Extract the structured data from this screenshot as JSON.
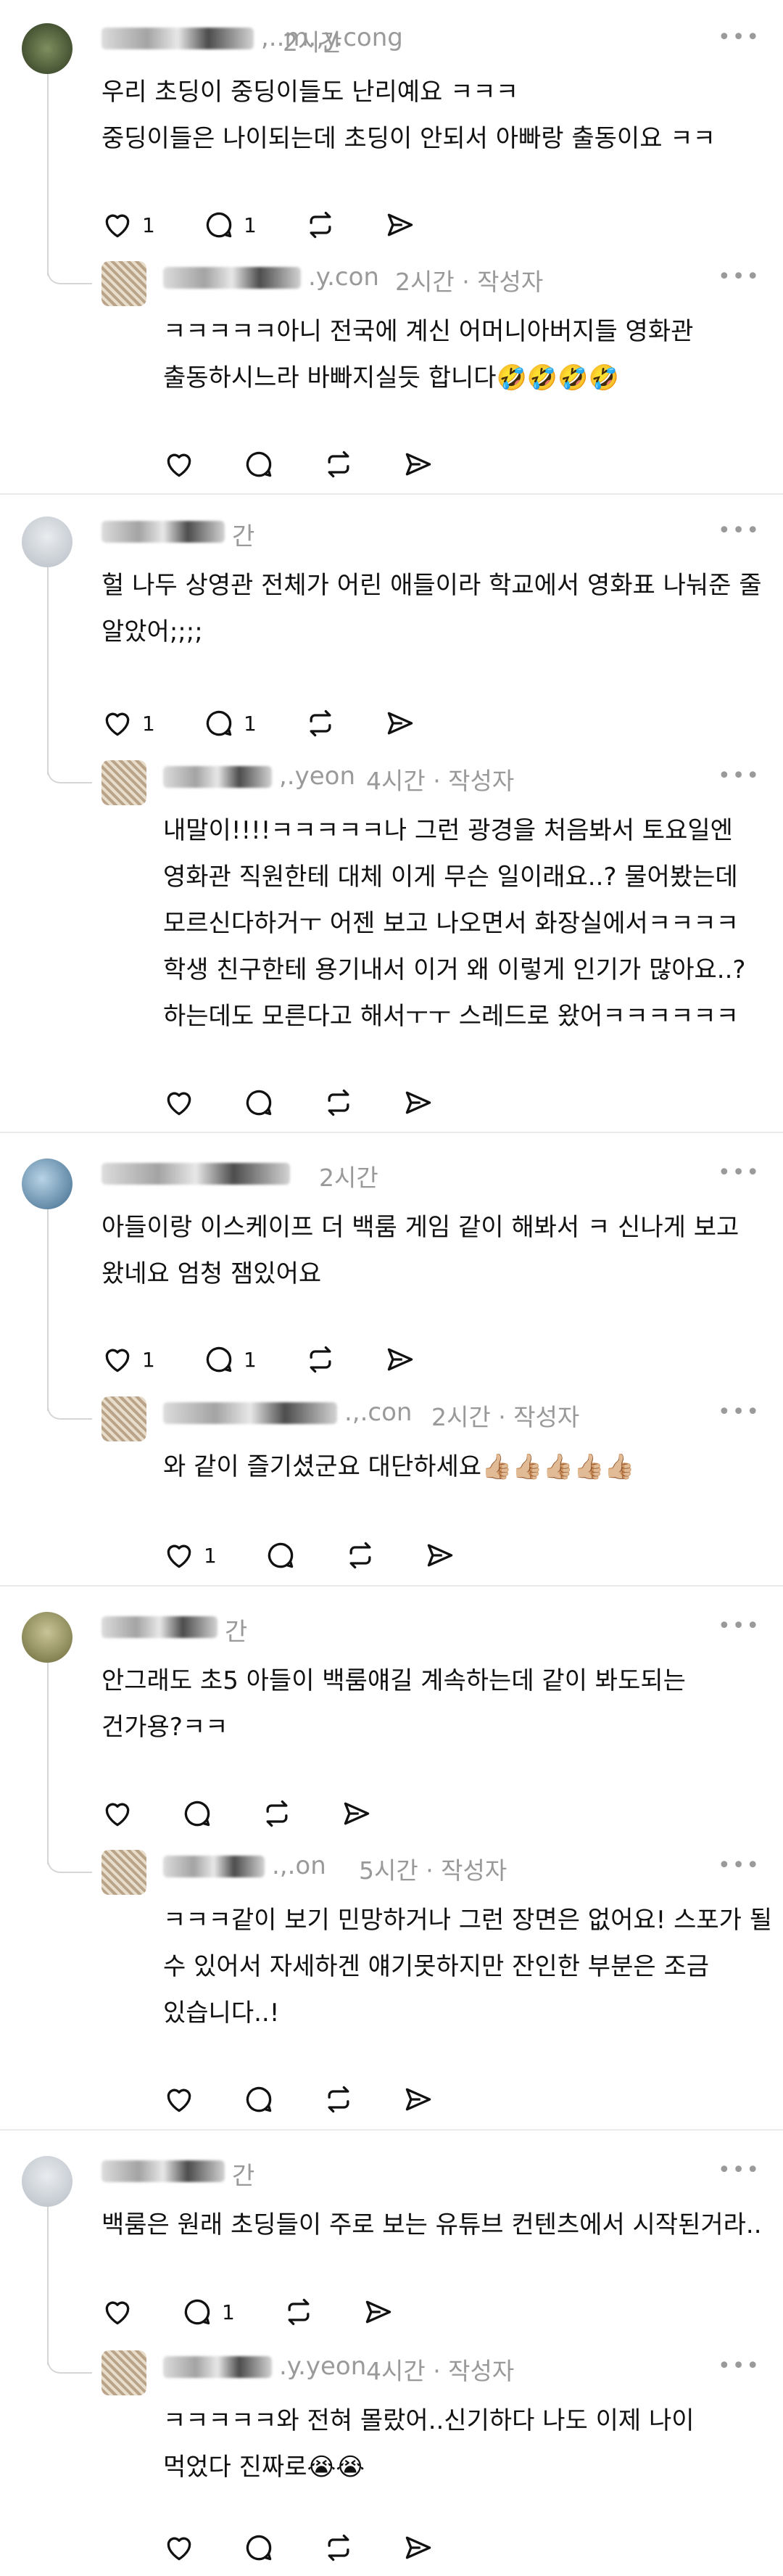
{
  "comments": [
    {
      "author_suffix": ",..m.,y.cong",
      "time": "2시간",
      "lines": [
        "우리 초딩이 중딩이들도 난리예요 ㅋㅋㅋ",
        "중딩이들은 나이되는데 초딩이 안되서 아빠랑 출동이요 ㅋㅋ"
      ],
      "likes": "1",
      "replies": "1",
      "reply": {
        "author_suffix": ".y.con",
        "meta": "2시간 · 작성자",
        "lines": [
          "ㅋㅋㅋㅋㅋ아니 전국에 계신 어머니아버지들 영화관",
          "출동하시느라 바빠지실듯 합니다🤣🤣🤣🤣"
        ],
        "likes": ""
      }
    },
    {
      "author_suffix": "간",
      "time": "",
      "lines": [
        "헐 나두 상영관 전체가 어린 애들이라 학교에서 영화표 나눠준 줄",
        "알았어;;;;"
      ],
      "likes": "1",
      "replies": "1",
      "reply": {
        "author_suffix": ",.yeon",
        "meta": "4시간 · 작성자",
        "lines": [
          "내말이!!!!ㅋㅋㅋㅋㅋ나 그런 광경을 처음봐서 토요일엔",
          "영화관 직원한테 대체 이게 무슨 일이래요..? 물어봤는데",
          "모르신다하거ㅜ 어젠 보고 나오면서 화장실에서ㅋㅋㅋㅋ",
          "학생 친구한테 용기내서 이거 왜 이렇게 인기가 많아요..?",
          "하는데도 모른다고 해서ㅜㅜ 스레드로 왔어ㅋㅋㅋㅋㅋㅋ"
        ],
        "likes": ""
      }
    },
    {
      "author_suffix": "",
      "time": "2시간",
      "lines": [
        "아들이랑 이스케이프 더 백룸 게임 같이 해봐서 ㅋ 신나게 보고",
        "왔네요 엄청 잼있어요"
      ],
      "likes": "1",
      "replies": "1",
      "reply": {
        "author_suffix": ".,.con",
        "meta": "2시간 · 작성자",
        "lines": [
          "와 같이 즐기셨군요 대단하세요👍🏼👍🏼👍🏼👍🏼👍🏼"
        ],
        "likes": "1"
      }
    },
    {
      "author_suffix": "간",
      "time": "",
      "lines": [
        "안그래도 초5 아들이 백룸얘길 계속하는데 같이 봐도되는",
        "건가용?ㅋㅋ"
      ],
      "likes": "",
      "replies": "",
      "reply": {
        "author_suffix": ".,.on",
        "meta": "5시간 · 작성자",
        "lines": [
          "ㅋㅋㅋ같이 보기 민망하거나 그런 장면은 없어요! 스포가 될",
          "수 있어서 자세하겐 얘기못하지만 잔인한 부분은 조금",
          "있습니다..!"
        ],
        "likes": ""
      }
    },
    {
      "author_suffix": "간",
      "time": "",
      "lines": [
        "백룸은 원래 초딩들이 주로 보는 유튜브 컨텐츠에서 시작된거라.."
      ],
      "likes": "",
      "replies": "1",
      "reply": {
        "author_suffix": ".y.yeon",
        "meta": "4시간 · 작성자",
        "lines": [
          "ㅋㅋㅋㅋㅋ와 전혀 몰랐어..신기하다 나도 이제 나이",
          "먹었다 진짜로😭😭"
        ],
        "likes": ""
      }
    }
  ],
  "more_label": "•••",
  "icons": [
    "heart-icon",
    "comment-icon",
    "repost-icon",
    "share-icon",
    "more-icon"
  ],
  "colors": {
    "text": "#111111",
    "meta": "#999999",
    "thread_line": "#d6d6d6",
    "divider": "#ebebeb"
  }
}
